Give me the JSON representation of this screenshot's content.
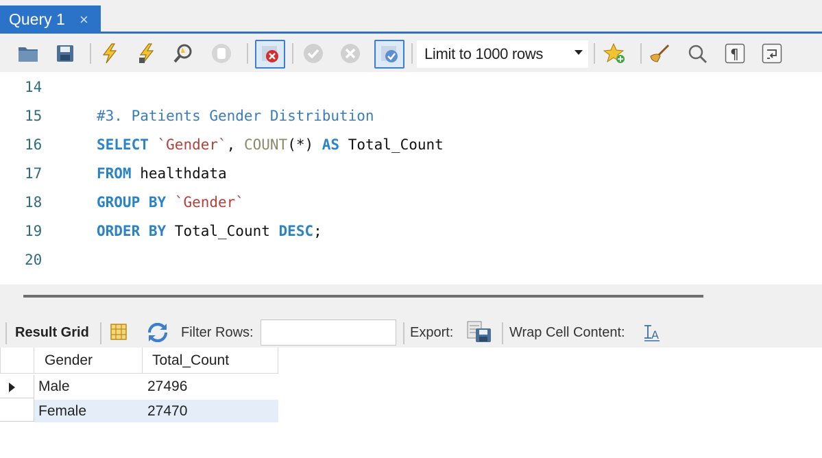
{
  "tab": {
    "title": "Query 1",
    "close": "×"
  },
  "toolbar": {
    "icons": [
      "folder-icon",
      "save-icon",
      "execute-icon",
      "execute-current-icon",
      "explain-icon",
      "stop-icon",
      "toggle-error-icon",
      "commit-icon",
      "rollback-icon",
      "autocommit-icon",
      "add-snippet-icon",
      "beautify-icon",
      "find-icon",
      "invisible-chars-icon",
      "wrap-icon"
    ],
    "limit": "Limit to 1000 rows"
  },
  "editor": {
    "lines": [
      {
        "num": "14"
      },
      {
        "num": "15",
        "comment": "#3. Patients Gender Distribution"
      },
      {
        "num": "16",
        "kw1": "SELECT",
        "str1": "`Gender`",
        "t1": ", ",
        "fn": "COUNT",
        "t2": "(*) ",
        "kw2": "AS",
        "t3": " Total_Count"
      },
      {
        "num": "17",
        "kw1": "FROM",
        "t1": " healthdata"
      },
      {
        "num": "18",
        "kw1": "GROUP BY",
        "str1": "`Gender`"
      },
      {
        "num": "19",
        "kw1": "ORDER BY",
        "t1": " Total_Count ",
        "kw2": "DESC",
        "t2": ";"
      },
      {
        "num": "20"
      }
    ]
  },
  "results": {
    "result_grid_label": "Result Grid",
    "filter_label": "Filter Rows:",
    "filter_value": "",
    "export_label": "Export:",
    "wrap_label": "Wrap Cell Content:",
    "columns": [
      "Gender",
      "Total_Count"
    ],
    "rows": [
      [
        "Male",
        "27496"
      ],
      [
        "Female",
        "27470"
      ]
    ]
  },
  "colors": {
    "accent": "#2a73c9",
    "keyword": "#2a83c7",
    "string": "#b3413a",
    "comment": "#3a7dbb"
  }
}
